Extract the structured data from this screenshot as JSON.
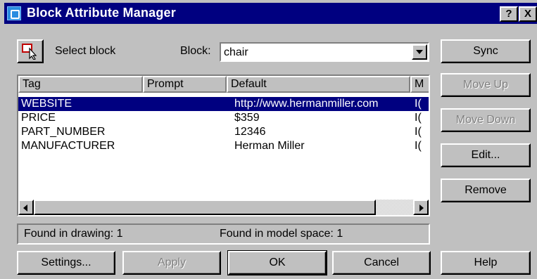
{
  "window": {
    "title": "Block Attribute Manager",
    "help_glyph": "?",
    "close_glyph": "X"
  },
  "select_block_label": "Select block",
  "block": {
    "label": "Block:",
    "value": "chair"
  },
  "columns": [
    "Tag",
    "Prompt",
    "Default",
    "M"
  ],
  "rows": [
    {
      "tag": "WEBSITE",
      "prompt": "",
      "default": "http://www.hermanmiller.com",
      "m": "I(",
      "selected": true
    },
    {
      "tag": "PRICE",
      "prompt": "",
      "default": "$359",
      "m": "I(",
      "selected": false
    },
    {
      "tag": "PART_NUMBER",
      "prompt": "",
      "default": "12346",
      "m": "I(",
      "selected": false
    },
    {
      "tag": "MANUFACTURER",
      "prompt": "",
      "default": "Herman Miller",
      "m": "I(",
      "selected": false
    }
  ],
  "status": {
    "found_in_drawing": "Found in drawing: 1",
    "found_in_model_space": "Found in model space: 1"
  },
  "buttons": {
    "sync": "Sync",
    "move_up": "Move Up",
    "move_down": "Move Down",
    "edit": "Edit...",
    "remove": "Remove",
    "settings": "Settings...",
    "apply": "Apply",
    "ok": "OK",
    "cancel": "Cancel",
    "help": "Help"
  },
  "icons": {
    "select_block": "pick-cursor-icon"
  }
}
